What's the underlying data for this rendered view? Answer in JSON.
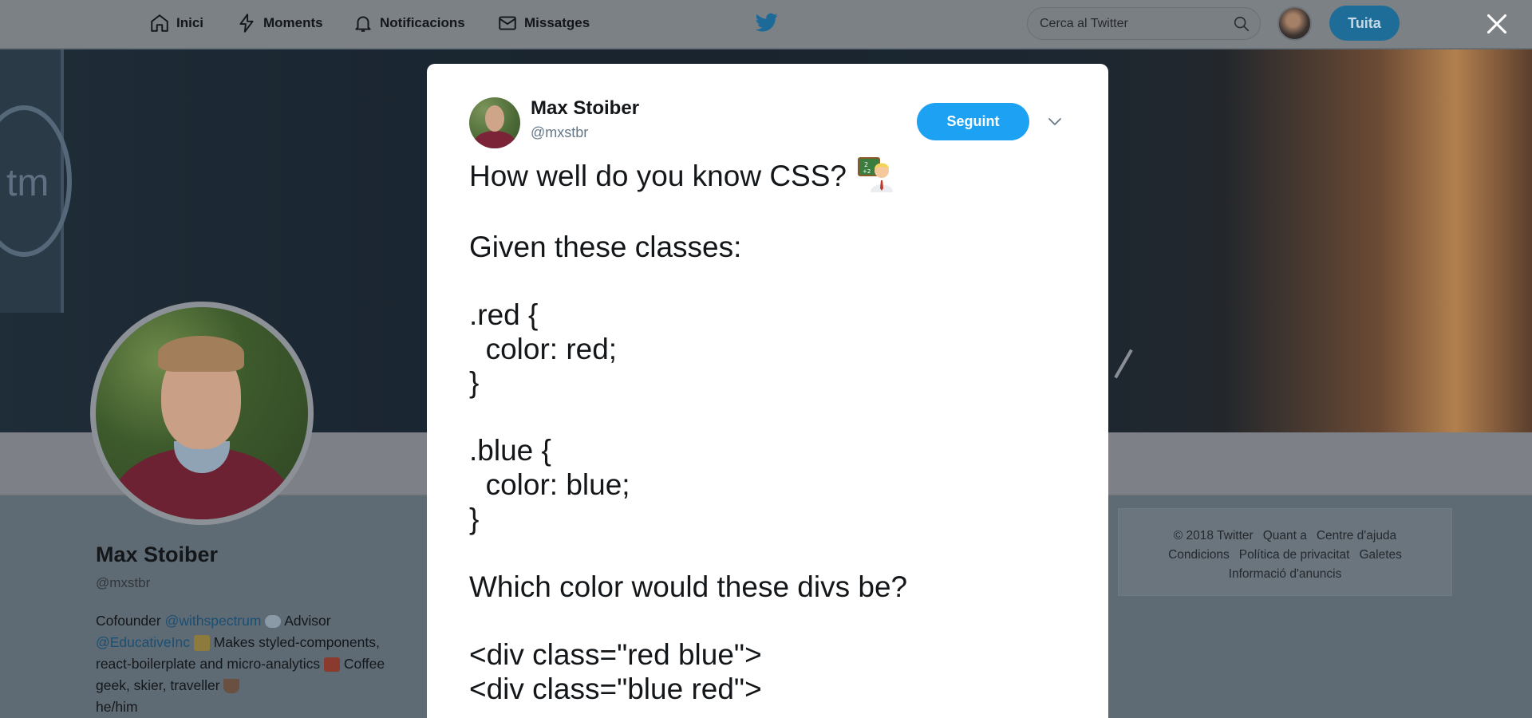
{
  "nav": {
    "home_label": "Inici",
    "moments_label": "Moments",
    "notifications_label": "Notificacions",
    "messages_label": "Missatges",
    "search_placeholder": "Cerca al Twitter",
    "tweet_button_label": "Tuita"
  },
  "profile": {
    "name": "Max Stoiber",
    "handle": "@mxstbr",
    "bio": {
      "part1": "Cofounder ",
      "link1": "@withspectrum",
      "part2": " Advisor",
      "link2": "@EducativeInc",
      "part3": " Makes styled-components, react-boilerplate and micro-analytics ",
      "part4": " Coffee geek, skier, traveller ",
      "part5": "he/him"
    }
  },
  "footer": {
    "row1": [
      "© 2018 Twitter",
      "Quant a",
      "Centre d'ajuda"
    ],
    "row2": [
      "Condicions",
      "Política de privacitat",
      "Galetes"
    ],
    "row3": [
      "Informació d'anuncis"
    ]
  },
  "modal": {
    "author_name": "Max Stoiber",
    "author_handle": "@mxstbr",
    "follow_label": "Seguint",
    "tweet_first_line": "How well do you know CSS?",
    "tweet_body": "\nGiven these classes:\n\n.red {\n  color: red;\n}\n\n.blue {\n  color: blue;\n}\n\nWhich color would these divs be?\n\n<div class=\"red blue\">\n<div class=\"blue red\">"
  }
}
